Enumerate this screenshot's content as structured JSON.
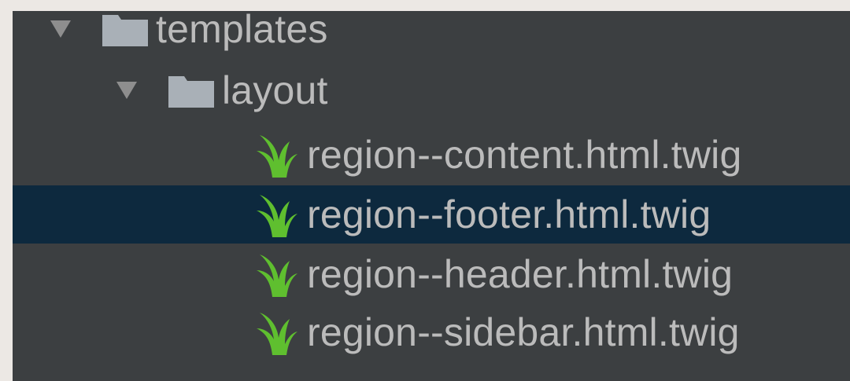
{
  "tree": {
    "colors": {
      "panel_background": "#3c3f41",
      "selected_row": "#0d293e",
      "text": "#bbbbbb",
      "folder_icon": "#a9b0b7",
      "twig_icon": "#5fbf2f"
    },
    "folders": [
      {
        "label": "templates",
        "icon": "folder-icon",
        "expanded": true
      },
      {
        "label": "layout",
        "icon": "folder-icon",
        "expanded": true
      }
    ],
    "files": [
      {
        "label": "region--content.html.twig",
        "icon": "twig-icon",
        "selected": false
      },
      {
        "label": "region--footer.html.twig",
        "icon": "twig-icon",
        "selected": true
      },
      {
        "label": "region--header.html.twig",
        "icon": "twig-icon",
        "selected": false
      },
      {
        "label": "region--sidebar.html.twig",
        "icon": "twig-icon",
        "selected": false
      }
    ]
  }
}
